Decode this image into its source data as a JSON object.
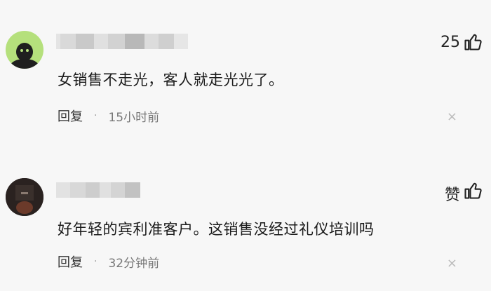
{
  "comments": [
    {
      "likes": "25",
      "text": "女销售不走光，客人就走光光了。",
      "reply_label": "回复",
      "separator": "·",
      "time": "15小时前",
      "close": "×"
    },
    {
      "likes": "赞",
      "text": "好年轻的宾利准客户。这销售没经过礼仪培训吗",
      "reply_label": "回复",
      "separator": "·",
      "time": "32分钟前",
      "close": "×"
    }
  ],
  "icons": {
    "like": "thumbs-up-icon",
    "close": "close-icon",
    "avatar1": "avatar-icon",
    "avatar2": "avatar-icon"
  },
  "colors": {
    "background": "#f7f7f7",
    "avatar1_bg": "#b5e07c",
    "avatar2_bg": "#2a2220"
  }
}
